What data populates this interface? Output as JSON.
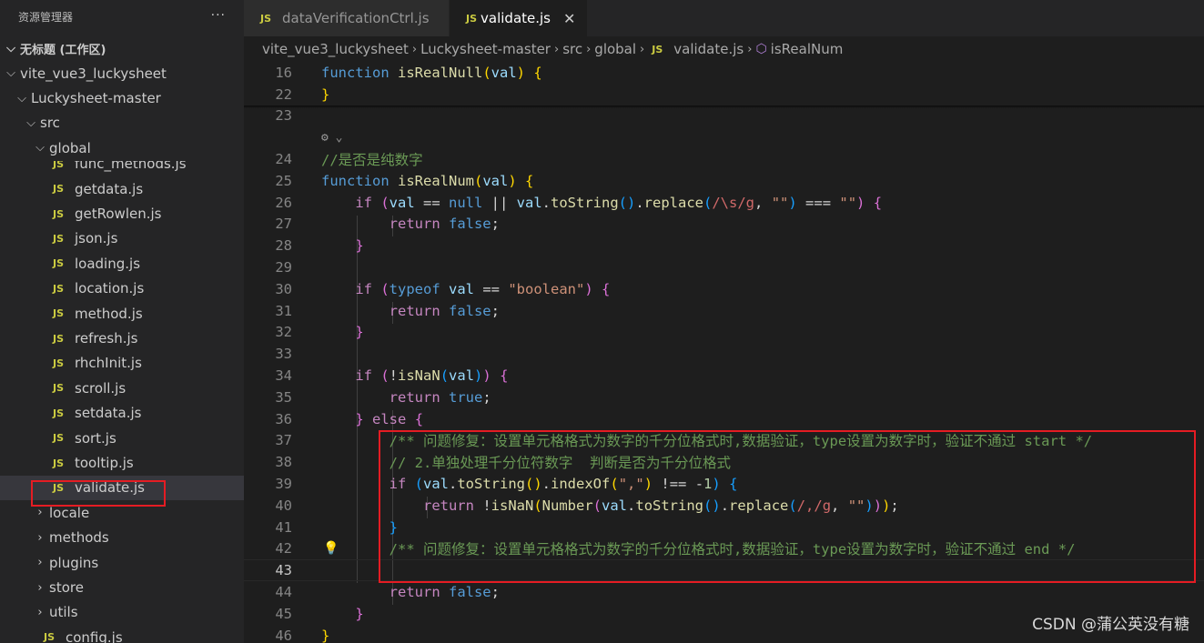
{
  "sidebar": {
    "title": "资源管理器",
    "more": "···",
    "workspace": "无标题 (工作区)",
    "items": [
      {
        "label": "vite_vue3_luckysheet",
        "type": "folder",
        "open": true,
        "depth": 1
      },
      {
        "label": "Luckysheet-master",
        "type": "folder",
        "open": true,
        "depth": 2
      },
      {
        "label": "src",
        "type": "folder",
        "open": true,
        "depth": 3
      },
      {
        "label": "global",
        "type": "folder",
        "open": true,
        "depth": 4
      },
      {
        "label": "func_methods.js",
        "type": "file",
        "depth": 5
      },
      {
        "label": "getdata.js",
        "type": "file",
        "depth": 5
      },
      {
        "label": "getRowlen.js",
        "type": "file",
        "depth": 5
      },
      {
        "label": "json.js",
        "type": "file",
        "depth": 5
      },
      {
        "label": "loading.js",
        "type": "file",
        "depth": 5
      },
      {
        "label": "location.js",
        "type": "file",
        "depth": 5
      },
      {
        "label": "method.js",
        "type": "file",
        "depth": 5
      },
      {
        "label": "refresh.js",
        "type": "file",
        "depth": 5
      },
      {
        "label": "rhchInit.js",
        "type": "file",
        "depth": 5
      },
      {
        "label": "scroll.js",
        "type": "file",
        "depth": 5
      },
      {
        "label": "setdata.js",
        "type": "file",
        "depth": 5
      },
      {
        "label": "sort.js",
        "type": "file",
        "depth": 5
      },
      {
        "label": "tooltip.js",
        "type": "file",
        "depth": 5
      },
      {
        "label": "validate.js",
        "type": "file",
        "depth": 5,
        "selected": true
      },
      {
        "label": "locale",
        "type": "folder",
        "open": false,
        "depth": 4
      },
      {
        "label": "methods",
        "type": "folder",
        "open": false,
        "depth": 4
      },
      {
        "label": "plugins",
        "type": "folder",
        "open": false,
        "depth": 4
      },
      {
        "label": "store",
        "type": "folder",
        "open": false,
        "depth": 4
      },
      {
        "label": "utils",
        "type": "folder",
        "open": false,
        "depth": 4
      },
      {
        "label": "config.js",
        "type": "file",
        "depth": 3
      }
    ]
  },
  "tabs": [
    {
      "label": "dataVerificationCtrl.js",
      "icon": "JS",
      "active": false
    },
    {
      "label": "validate.js",
      "icon": "JS",
      "active": true,
      "close": "✕"
    }
  ],
  "breadcrumb": {
    "parts": [
      "vite_vue3_luckysheet",
      "Luckysheet-master",
      "src",
      "global"
    ],
    "file": "validate.js",
    "file_icon": "JS",
    "symbol": "isRealNum"
  },
  "editor": {
    "sticky_lines": [
      {
        "num": "16",
        "tokens": [
          [
            "kw",
            "function "
          ],
          [
            "fn",
            "isRealNull"
          ],
          [
            "b1",
            "("
          ],
          [
            "var",
            "val"
          ],
          [
            "b1",
            ")"
          ],
          [
            "",
            ""
          ],
          [
            "",
            " "
          ],
          [
            "b1",
            "{"
          ]
        ]
      },
      {
        "num": "22",
        "tokens": [
          [
            "b1",
            "}"
          ]
        ]
      }
    ],
    "lines": [
      {
        "num": "23",
        "tokens": []
      },
      {
        "num": "",
        "lens": true,
        "tokens": []
      },
      {
        "num": "24",
        "tokens": [
          [
            "cm",
            "//是否是纯数字"
          ]
        ]
      },
      {
        "num": "25",
        "tokens": [
          [
            "kw",
            "function "
          ],
          [
            "fn",
            "isRealNum"
          ],
          [
            "b1",
            "("
          ],
          [
            "var",
            "val"
          ],
          [
            "b1",
            ")"
          ],
          [
            "",
            " "
          ],
          [
            "b1",
            "{"
          ]
        ]
      },
      {
        "num": "26",
        "tokens": [
          [
            "",
            "    "
          ],
          [
            "ctl",
            "if "
          ],
          [
            "b2",
            "("
          ],
          [
            "var",
            "val"
          ],
          [
            "",
            " == "
          ],
          [
            "kw",
            "null"
          ],
          [
            "",
            " || "
          ],
          [
            "var",
            "val"
          ],
          [
            "",
            "."
          ],
          [
            "fn",
            "toString"
          ],
          [
            "b3",
            "()"
          ],
          [
            "",
            "."
          ],
          [
            "fn",
            "replace"
          ],
          [
            "b3",
            "("
          ],
          [
            "rx",
            "/\\s/g"
          ],
          [
            "",
            ", "
          ],
          [
            "str",
            "\"\""
          ],
          [
            "b3",
            ")"
          ],
          [
            "",
            " === "
          ],
          [
            "str",
            "\"\""
          ],
          [
            "b2",
            ")"
          ],
          [
            "",
            " "
          ],
          [
            "b2",
            "{"
          ]
        ]
      },
      {
        "num": "27",
        "tokens": [
          [
            "",
            "        "
          ],
          [
            "ctl",
            "return "
          ],
          [
            "kw",
            "false"
          ],
          [
            "",
            ";"
          ]
        ]
      },
      {
        "num": "28",
        "tokens": [
          [
            "",
            "    "
          ],
          [
            "b2",
            "}"
          ]
        ]
      },
      {
        "num": "29",
        "tokens": []
      },
      {
        "num": "30",
        "tokens": [
          [
            "",
            "    "
          ],
          [
            "ctl",
            "if "
          ],
          [
            "b2",
            "("
          ],
          [
            "kw",
            "typeof "
          ],
          [
            "var",
            "val"
          ],
          [
            "",
            " == "
          ],
          [
            "str",
            "\"boolean\""
          ],
          [
            "b2",
            ")"
          ],
          [
            "",
            " "
          ],
          [
            "b2",
            "{"
          ]
        ]
      },
      {
        "num": "31",
        "tokens": [
          [
            "",
            "        "
          ],
          [
            "ctl",
            "return "
          ],
          [
            "kw",
            "false"
          ],
          [
            "",
            ";"
          ]
        ]
      },
      {
        "num": "32",
        "tokens": [
          [
            "",
            "    "
          ],
          [
            "b2",
            "}"
          ]
        ]
      },
      {
        "num": "33",
        "tokens": []
      },
      {
        "num": "34",
        "tokens": [
          [
            "",
            "    "
          ],
          [
            "ctl",
            "if "
          ],
          [
            "b2",
            "("
          ],
          [
            "",
            "!"
          ],
          [
            "fn",
            "isNaN"
          ],
          [
            "b3",
            "("
          ],
          [
            "var",
            "val"
          ],
          [
            "b3",
            ")"
          ],
          [
            "b2",
            ")"
          ],
          [
            "",
            " "
          ],
          [
            "b2",
            "{"
          ]
        ]
      },
      {
        "num": "35",
        "tokens": [
          [
            "",
            "        "
          ],
          [
            "ctl",
            "return "
          ],
          [
            "kw",
            "true"
          ],
          [
            "",
            ";"
          ]
        ]
      },
      {
        "num": "36",
        "tokens": [
          [
            "",
            "    "
          ],
          [
            "b2",
            "}"
          ],
          [
            "",
            " "
          ],
          [
            "ctl",
            "else "
          ],
          [
            "b2",
            "{"
          ]
        ]
      },
      {
        "num": "37",
        "tokens": [
          [
            "",
            "        "
          ],
          [
            "cm",
            "/** 问题修复：设置单元格格式为数字的千分位格式时,数据验证，type设置为数字时，验证不通过 start */"
          ]
        ]
      },
      {
        "num": "38",
        "tokens": [
          [
            "",
            "        "
          ],
          [
            "cm",
            "// 2.单独处理千分位符数字  判断是否为千分位格式"
          ]
        ]
      },
      {
        "num": "39",
        "tokens": [
          [
            "",
            "        "
          ],
          [
            "ctl",
            "if "
          ],
          [
            "b3",
            "("
          ],
          [
            "var",
            "val"
          ],
          [
            "",
            "."
          ],
          [
            "fn",
            "toString"
          ],
          [
            "b1",
            "()"
          ],
          [
            "",
            "."
          ],
          [
            "fn",
            "indexOf"
          ],
          [
            "b1",
            "("
          ],
          [
            "str",
            "\",\""
          ],
          [
            "b1",
            ")"
          ],
          [
            "",
            " !== "
          ],
          [
            "",
            "-"
          ],
          [
            "num",
            "1"
          ],
          [
            "b3",
            ")"
          ],
          [
            "",
            " "
          ],
          [
            "b3",
            "{"
          ]
        ]
      },
      {
        "num": "40",
        "tokens": [
          [
            "",
            "            "
          ],
          [
            "ctl",
            "return "
          ],
          [
            "",
            "!"
          ],
          [
            "fn",
            "isNaN"
          ],
          [
            "b1",
            "("
          ],
          [
            "fn",
            "Number"
          ],
          [
            "b2",
            "("
          ],
          [
            "var",
            "val"
          ],
          [
            "",
            "."
          ],
          [
            "fn",
            "toString"
          ],
          [
            "b3",
            "()"
          ],
          [
            "",
            "."
          ],
          [
            "fn",
            "replace"
          ],
          [
            "b3",
            "("
          ],
          [
            "rx",
            "/,/g"
          ],
          [
            "",
            ", "
          ],
          [
            "str",
            "\"\""
          ],
          [
            "b3",
            ")"
          ],
          [
            "b2",
            ")"
          ],
          [
            "b1",
            ")"
          ],
          [
            "",
            ";"
          ]
        ]
      },
      {
        "num": "41",
        "tokens": [
          [
            "",
            "        "
          ],
          [
            "b3",
            "}"
          ]
        ]
      },
      {
        "num": "42",
        "bulb": true,
        "tokens": [
          [
            "",
            "        "
          ],
          [
            "cm",
            "/** 问题修复：设置单元格格式为数字的千分位格式时,数据验证，type设置为数字时，验证不通过 end */"
          ]
        ]
      },
      {
        "num": "43",
        "current": true,
        "tokens": []
      },
      {
        "num": "44",
        "tokens": [
          [
            "",
            "        "
          ],
          [
            "ctl",
            "return "
          ],
          [
            "kw",
            "false"
          ],
          [
            "",
            ";"
          ]
        ]
      },
      {
        "num": "45",
        "tokens": [
          [
            "",
            "    "
          ],
          [
            "b2",
            "}"
          ]
        ]
      },
      {
        "num": "46",
        "tokens": [
          [
            "b1",
            "}"
          ]
        ]
      }
    ]
  },
  "watermark": "CSDN @蒲公英没有糖",
  "colors": {
    "highlight_box": "#e51c23",
    "accent": "#007acc"
  }
}
